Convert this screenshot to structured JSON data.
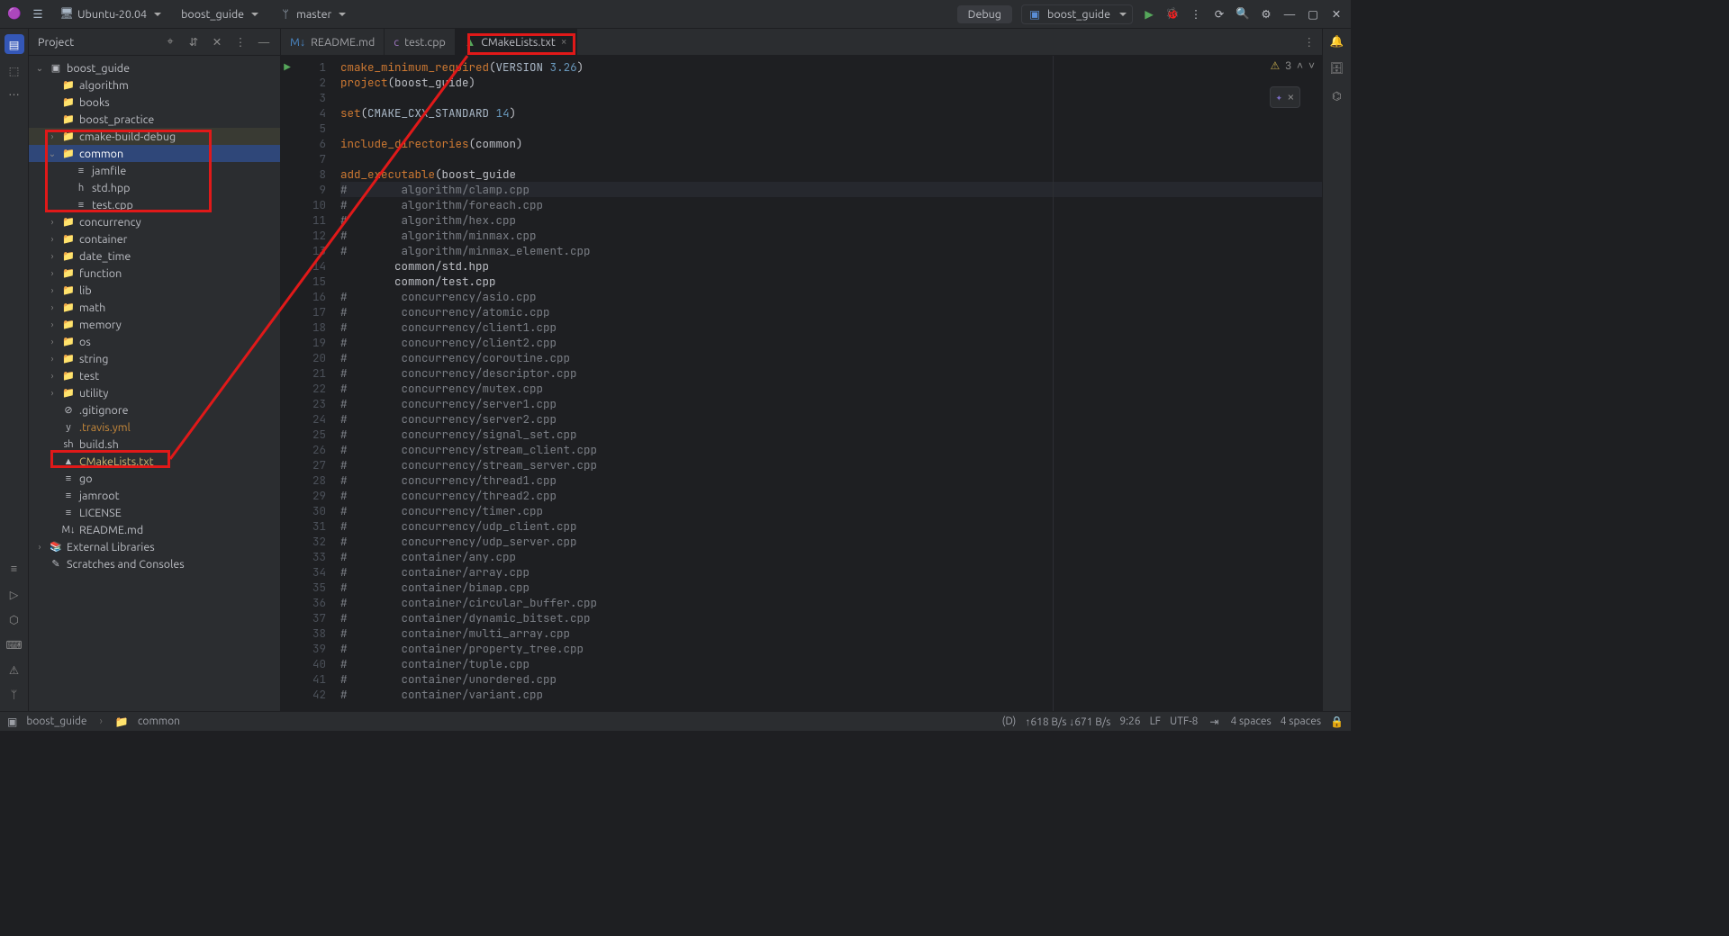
{
  "titlebar": {
    "os_label": "Ubuntu-20.04",
    "project_label": "boost_guide",
    "vcs_label": "master",
    "debug_btn": "Debug",
    "run_config": "boost_guide"
  },
  "project_panel": {
    "title": "Project"
  },
  "tree": {
    "root": "boost_guide",
    "items": [
      {
        "d": 1,
        "expand": " ",
        "ico": "📁",
        "name": "algorithm"
      },
      {
        "d": 1,
        "expand": " ",
        "ico": "📁",
        "name": "books"
      },
      {
        "d": 1,
        "expand": "",
        "ico": "📁",
        "name": "boost_practice"
      },
      {
        "d": 1,
        "expand": ">",
        "ico": "📁",
        "name": "cmake-build-debug",
        "hl": true
      },
      {
        "d": 1,
        "expand": "v",
        "ico": "📁",
        "name": "common",
        "sel": true
      },
      {
        "d": 2,
        "expand": "",
        "ico": "≡",
        "name": "jamfile"
      },
      {
        "d": 2,
        "expand": "",
        "ico": "h",
        "name": "std.hpp"
      },
      {
        "d": 2,
        "expand": "",
        "ico": "≡",
        "name": "test.cpp"
      },
      {
        "d": 1,
        "expand": ">",
        "ico": "📁",
        "name": "concurrency"
      },
      {
        "d": 1,
        "expand": ">",
        "ico": "📁",
        "name": "container"
      },
      {
        "d": 1,
        "expand": ">",
        "ico": "📁",
        "name": "date_time"
      },
      {
        "d": 1,
        "expand": ">",
        "ico": "📁",
        "name": "function"
      },
      {
        "d": 1,
        "expand": ">",
        "ico": "📁",
        "name": "lib"
      },
      {
        "d": 1,
        "expand": ">",
        "ico": "📁",
        "name": "math"
      },
      {
        "d": 1,
        "expand": ">",
        "ico": "📁",
        "name": "memory"
      },
      {
        "d": 1,
        "expand": ">",
        "ico": "📁",
        "name": "os"
      },
      {
        "d": 1,
        "expand": ">",
        "ico": "📁",
        "name": "string"
      },
      {
        "d": 1,
        "expand": ">",
        "ico": "📁",
        "name": "test"
      },
      {
        "d": 1,
        "expand": ">",
        "ico": "📁",
        "name": "utility"
      },
      {
        "d": 1,
        "expand": "",
        "ico": "⊘",
        "name": ".gitignore"
      },
      {
        "d": 1,
        "expand": "",
        "ico": "y",
        "name": ".travis.yml",
        "cls": "fname-yml"
      },
      {
        "d": 1,
        "expand": "",
        "ico": "sh",
        "name": "build.sh"
      },
      {
        "d": 1,
        "expand": "",
        "ico": "▲",
        "name": "CMakeLists.txt",
        "cls": "fname-active"
      },
      {
        "d": 1,
        "expand": "",
        "ico": "≡",
        "name": "go"
      },
      {
        "d": 1,
        "expand": "",
        "ico": "≡",
        "name": "jamroot"
      },
      {
        "d": 1,
        "expand": "",
        "ico": "≡",
        "name": "LICENSE"
      },
      {
        "d": 1,
        "expand": "",
        "ico": "M↓",
        "name": "README.md"
      }
    ],
    "ext_lib": "External Libraries",
    "scratches": "Scratches and Consoles"
  },
  "tabs": [
    {
      "ico": "M↓",
      "label": "README.md"
    },
    {
      "ico": "c",
      "label": "test.cpp"
    },
    {
      "ico": "▲",
      "label": "CMakeLists.txt",
      "active": true
    }
  ],
  "inspect": {
    "count": "3"
  },
  "code": [
    "cmake_minimum_required(VERSION 3.26)",
    "project(boost_guide)",
    "",
    "set(CMAKE_CXX_STANDARD 14)",
    "",
    "include_directories(common)",
    "",
    "add_executable(boost_guide",
    "#        algorithm/clamp.cpp",
    "#        algorithm/foreach.cpp",
    "#        algorithm/hex.cpp",
    "#        algorithm/minmax.cpp",
    "#        algorithm/minmax_element.cpp",
    "        common/std.hpp",
    "        common/test.cpp",
    "#        concurrency/asio.cpp",
    "#        concurrency/atomic.cpp",
    "#        concurrency/client1.cpp",
    "#        concurrency/client2.cpp",
    "#        concurrency/coroutine.cpp",
    "#        concurrency/descriptor.cpp",
    "#        concurrency/mutex.cpp",
    "#        concurrency/server1.cpp",
    "#        concurrency/server2.cpp",
    "#        concurrency/signal_set.cpp",
    "#        concurrency/stream_client.cpp",
    "#        concurrency/stream_server.cpp",
    "#        concurrency/thread1.cpp",
    "#        concurrency/thread2.cpp",
    "#        concurrency/timer.cpp",
    "#        concurrency/udp_client.cpp",
    "#        concurrency/udp_server.cpp",
    "#        container/any.cpp",
    "#        container/array.cpp",
    "#        container/bimap.cpp",
    "#        container/circular_buffer.cpp",
    "#        container/dynamic_bitset.cpp",
    "#        container/multi_array.cpp",
    "#        container/property_tree.cpp",
    "#        container/tuple.cpp",
    "#        container/unordered.cpp",
    "#        container/variant.cpp"
  ],
  "status": {
    "crumb1": "boost_guide",
    "crumb2": "common",
    "disk": "(D)",
    "net": "↑618 B/s  ↓671 B/s",
    "pos": "9:26",
    "sep": "LF",
    "enc": "UTF-8",
    "indent1": "4 spaces",
    "indent2": "4 spaces"
  }
}
